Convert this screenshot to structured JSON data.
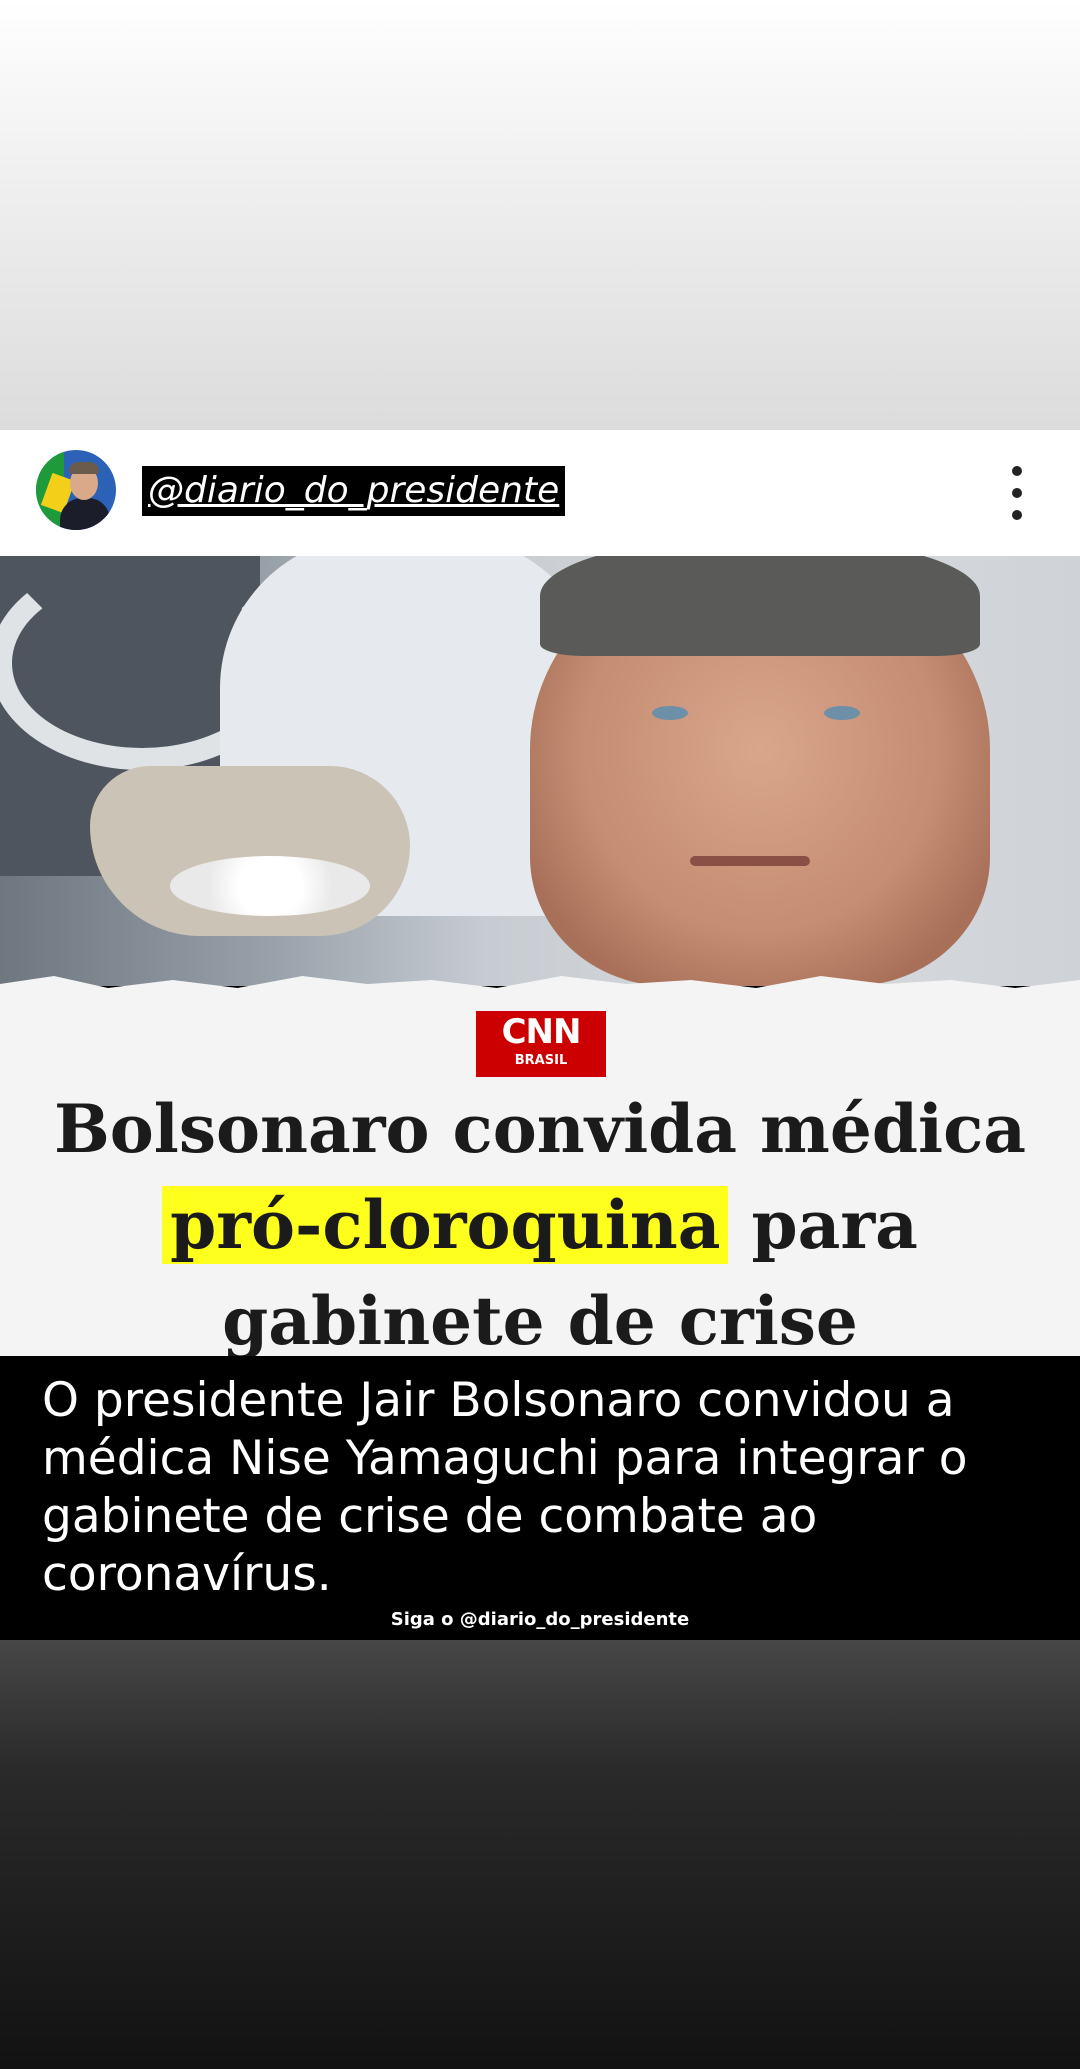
{
  "post": {
    "username": "@diario_do_presidente",
    "menu_icon": "more-vertical-icon"
  },
  "image": {
    "logo": {
      "brand": "CNN",
      "sub": "BRASIL",
      "color": "#cc0000"
    },
    "headline": {
      "line1": "Bolsonaro convida médica",
      "line2_highlight": "pró-cloroquina",
      "line2_rest": " para",
      "line3": "gabinete de crise",
      "highlight_color": "#ffff1e"
    },
    "body": "O presidente Jair Bolsonaro convidou a médica Nise Yamaguchi para integrar o gabinete de crise de combate ao coronavírus.",
    "watermark": "Siga o @diario_do_presidente"
  }
}
